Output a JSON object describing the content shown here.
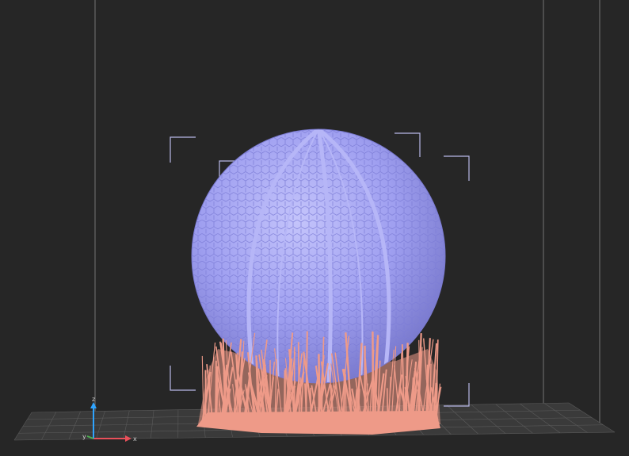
{
  "viewport": {
    "background": "#262626",
    "grid_color": "#5a5a5a",
    "plate_color": "#3a3a3a",
    "frame_color": "#8a8a8a",
    "bracket_color": "#b8b8e8"
  },
  "model": {
    "body_color": "#9f9ff0",
    "hex_color": "#7c7cd6",
    "seam_color": "#b6b6f7",
    "support_color": "#ee9a88"
  },
  "axes": {
    "x_label": "x",
    "y_label": "y",
    "z_label": "z",
    "x_color": "#e8505a",
    "y_color": "#4caf50",
    "z_color": "#2ea4ff"
  }
}
